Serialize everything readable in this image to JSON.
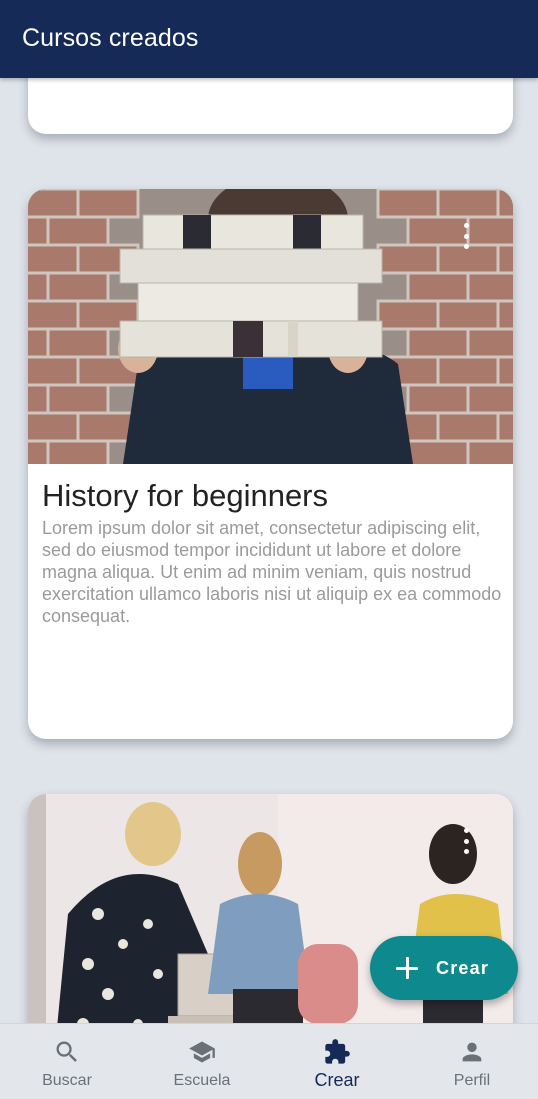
{
  "app_bar": {
    "title": "Cursos creados"
  },
  "courses": [
    {
      "title": "",
      "description": ""
    },
    {
      "title": "History for beginners",
      "description": "Lorem ipsum dolor sit amet, consectetur adipiscing elit, sed do eiusmod tempor incididunt ut labore et dolore magna aliqua. Ut enim ad minim veniam, quis nostrud exercitation ullamco laboris nisi ut aliquip ex ea commodo consequat.",
      "image_icon": "books-stack-photo",
      "menu_icon": "more-vertical-icon"
    },
    {
      "title": "",
      "description": "",
      "image_icon": "group-meeting-photo",
      "menu_icon": "more-vertical-icon"
    }
  ],
  "fab": {
    "label": "Crear",
    "icon": "plus-icon",
    "color": "#0e8a8e"
  },
  "bottom_nav": {
    "items": [
      {
        "label": "Buscar",
        "icon": "search-icon",
        "active": false
      },
      {
        "label": "Escuela",
        "icon": "school-icon",
        "active": false
      },
      {
        "label": "Crear",
        "icon": "puzzle-icon",
        "active": true
      },
      {
        "label": "Perfil",
        "icon": "person-icon",
        "active": false
      }
    ]
  },
  "colors": {
    "primary": "#152a56",
    "accent": "#0e8a8e",
    "background": "#dfe4ea"
  }
}
